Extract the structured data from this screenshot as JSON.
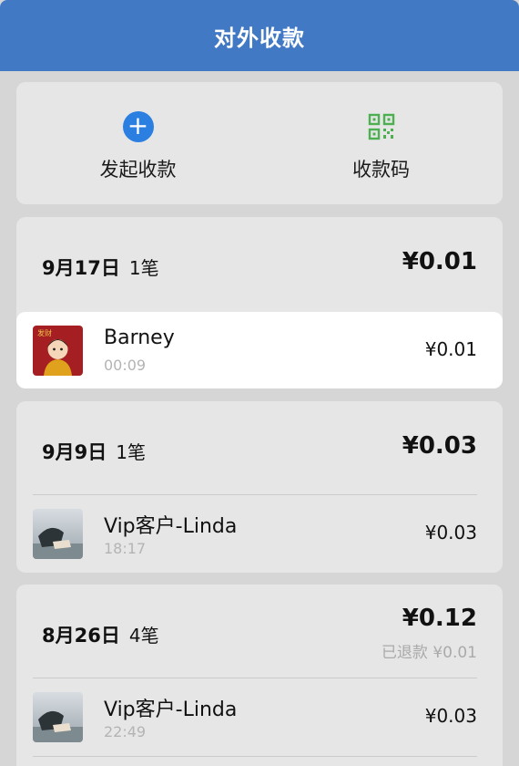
{
  "header": {
    "title": "对外收款"
  },
  "actions": [
    {
      "label": "发起收款",
      "icon": "plus-circle-icon",
      "color": "#2b7fe0"
    },
    {
      "label": "收款码",
      "icon": "qr-code-icon",
      "color": "#4caf50"
    }
  ],
  "groups": [
    {
      "date": "9月17日",
      "count": "1笔",
      "total": "¥0.01",
      "transactions": [
        {
          "name": "Barney",
          "time": "00:09",
          "amount": "¥0.01",
          "avatar": "red-avatar",
          "avatar_text": "发财"
        }
      ]
    },
    {
      "date": "9月9日",
      "count": "1笔",
      "total": "¥0.03",
      "transactions": [
        {
          "name": "Vip客户-Linda",
          "time": "18:17",
          "amount": "¥0.03",
          "avatar": "photo-avatar"
        }
      ]
    },
    {
      "date": "8月26日",
      "count": "4笔",
      "total": "¥0.12",
      "refund": "已退款 ¥0.01",
      "transactions": [
        {
          "name": "Vip客户-Linda",
          "time": "22:49",
          "amount": "¥0.03",
          "avatar": "photo-avatar"
        }
      ]
    }
  ]
}
